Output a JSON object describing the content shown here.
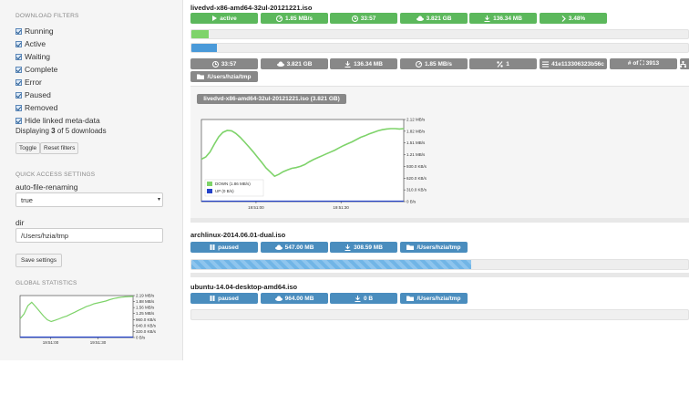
{
  "sidebar": {
    "filters_heading": "DOWNLOAD FILTERS",
    "filters": [
      {
        "label": "Running",
        "checked": true
      },
      {
        "label": "Active",
        "checked": true
      },
      {
        "label": "Waiting",
        "checked": true
      },
      {
        "label": "Complete",
        "checked": true
      },
      {
        "label": "Error",
        "checked": true
      },
      {
        "label": "Paused",
        "checked": true
      },
      {
        "label": "Removed",
        "checked": true
      },
      {
        "label": "Hide linked meta-data",
        "checked": true
      }
    ],
    "displaying_pre": "Displaying ",
    "displaying_count": "3",
    "displaying_post": " of 5 downloads",
    "toggle_label": "Toggle",
    "reset_label": "Reset filters",
    "quick_heading": "QUICK ACCESS SETTINGS",
    "autorename_label": "auto-file-renaming",
    "autorename_value": "true",
    "dir_label": "dir",
    "dir_value": "/Users/hzia/tmp",
    "save_label": "Save settings",
    "global_heading": "GLOBAL STATISTICS",
    "global_chart": {
      "yticks": [
        "2.19 MB/s",
        "1.88 MB/s",
        "1.56 MB/s",
        "1.25 MB/s",
        "960.0 KB/s",
        "640.0 KB/s",
        "320.0 KB/s",
        "0 B/s"
      ],
      "xticks": [
        "19:51:00",
        "19:51:30"
      ]
    }
  },
  "downloads": [
    {
      "name": "livedvd-x86-amd64-32ul-20121221.iso",
      "tags": [
        {
          "icon": "play-icon",
          "text": "active"
        },
        {
          "icon": "speed-icon",
          "text": "1.85 MB/s"
        },
        {
          "icon": "clock-icon",
          "text": "33:57"
        },
        {
          "icon": "cloud-icon",
          "text": "3.821 GB"
        },
        {
          "icon": "download-icon",
          "text": "136.34 MB"
        },
        {
          "icon": "chevron-right-icon",
          "text": "3.48%"
        }
      ],
      "progress": 0.0348,
      "details": [
        {
          "icon": "clock-icon",
          "text": "33:57"
        },
        {
          "icon": "cloud-icon",
          "text": "3.821 GB"
        },
        {
          "icon": "download-icon",
          "text": "136.34 MB"
        },
        {
          "icon": "speed-icon",
          "text": "1.85 MB/s"
        },
        {
          "icon": "percent-icon",
          "text": "1"
        },
        {
          "icon": "list-icon",
          "text": "41e113306323b56c"
        },
        {
          "icon": "none",
          "text": "# of ⛶ 3913"
        },
        {
          "icon": "sitemap-icon",
          "text": ""
        }
      ],
      "path": "/Users/hzia/tmp",
      "chart_title": "livedvd-x86-amd64-32ul-20121221.iso (3.821 GB)"
    },
    {
      "name": "archlinux-2014.06.01-dual.iso",
      "tags": [
        {
          "icon": "pause-icon",
          "text": "paused"
        },
        {
          "icon": "cloud-icon",
          "text": "547.00 MB"
        },
        {
          "icon": "download-icon",
          "text": "308.59 MB"
        },
        {
          "icon": "folder-icon",
          "text": "/Users/hzia/tmp"
        }
      ],
      "progress": 0.5641
    },
    {
      "name": "ubuntu-14.04-desktop-amd64.iso",
      "tags": [
        {
          "icon": "pause-icon",
          "text": "paused"
        },
        {
          "icon": "cloud-icon",
          "text": "964.00 MB"
        },
        {
          "icon": "download-icon",
          "text": "0 B"
        },
        {
          "icon": "folder-icon",
          "text": "/Users/hzia/tmp"
        }
      ],
      "progress": 0
    }
  ],
  "chart_data": [
    {
      "type": "line",
      "title": "livedvd-x86-amd64-32ul-20121221.iso (3.821 GB)",
      "y_unit": "KB/s",
      "yticks": [
        "2.12 MB/s",
        "1.82 MB/s",
        "1.51 MB/s",
        "1.21 MB/s",
        "930.0 KB/s",
        "620.0 KB/s",
        "310.0 KB/s",
        "0 B/s"
      ],
      "ylim": [
        0,
        2170
      ],
      "xticks": [
        "19:51:00",
        "19:51:30"
      ],
      "legend_placement": "bottom-left",
      "series": [
        {
          "name": "DOWN (1.86 MB/s)",
          "color": "#7ed36a",
          "values": [
            1120,
            1180,
            1310,
            1520,
            1710,
            1830,
            1880,
            1870,
            1800,
            1700,
            1580,
            1450,
            1320,
            1180,
            1040,
            890,
            780,
            670,
            720,
            790,
            840,
            880,
            900,
            930,
            980,
            1050,
            1110,
            1160,
            1210,
            1260,
            1310,
            1360,
            1420,
            1480,
            1530,
            1580,
            1640,
            1700,
            1740,
            1790,
            1830,
            1870,
            1900,
            1920,
            1930,
            1930,
            1920,
            1930
          ]
        },
        {
          "name": "UP (0 B/s)",
          "color": "#2443c9",
          "values": [
            0,
            0,
            0,
            0,
            0,
            0,
            0,
            0,
            0,
            0,
            0,
            0,
            0,
            0,
            0,
            0,
            0,
            0,
            0,
            0,
            0,
            0,
            0,
            0,
            0,
            0,
            0,
            0,
            0,
            0,
            0,
            0,
            0,
            0,
            0,
            0,
            0,
            0,
            0,
            0,
            0,
            0,
            0,
            0,
            0,
            0,
            0,
            0
          ]
        }
      ]
    },
    {
      "type": "line",
      "yticks": [
        "2.19 MB/s",
        "1.88 MB/s",
        "1.56 MB/s",
        "1.25 MB/s",
        "960.0 KB/s",
        "640.0 KB/s",
        "320.0 KB/s",
        "0 B/s"
      ],
      "ylim": [
        0,
        2240
      ],
      "xticks": [
        "19:51:00",
        "19:51:30"
      ],
      "series": [
        {
          "color": "#7ed36a",
          "values": [
            1000,
            1250,
            1700,
            1880,
            1650,
            1400,
            1150,
            950,
            850,
            920,
            1000,
            1080,
            1150,
            1250,
            1350,
            1450,
            1550,
            1650,
            1720,
            1800,
            1850,
            1900,
            1950,
            2020,
            2080,
            2120,
            2150,
            2170,
            2180,
            2190
          ]
        },
        {
          "color": "#2443c9",
          "values": [
            0,
            0,
            0,
            0,
            0,
            0,
            0,
            0,
            0,
            0,
            0,
            0,
            0,
            0,
            0,
            0,
            0,
            0,
            0,
            0,
            0,
            0,
            0,
            0,
            0,
            0,
            0,
            0,
            0,
            0
          ]
        }
      ]
    }
  ]
}
